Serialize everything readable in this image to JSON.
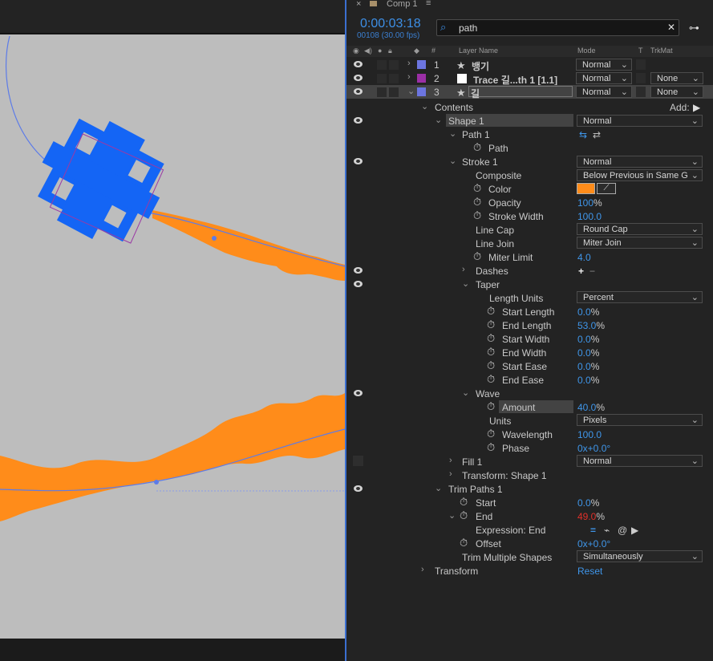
{
  "panel_tab": {
    "close_glyph": "×",
    "title": "Comp 1",
    "menu_glyph": "≡"
  },
  "timeline": {
    "timecode": "0:00:03:18",
    "frame_info": "00108 (30.00 fps)"
  },
  "search": {
    "value": "path",
    "icon": "search-icon",
    "clear_glyph": "✕"
  },
  "columns": {
    "label": "#",
    "name": "Layer Name",
    "mode": "Mode",
    "t": "T",
    "trkmat": "TrkMat"
  },
  "layers": [
    {
      "num": "1",
      "name": "뱅기",
      "mode": "Normal",
      "label_color": "#6c75e0",
      "icon": "star-icon"
    },
    {
      "num": "2",
      "name": "Trace 길...th 1 [1.1]",
      "mode": "Normal",
      "trkmat": "None",
      "label_color": "#9b2fa5",
      "icon": "solid-icon"
    },
    {
      "num": "3",
      "name": "길",
      "mode": "Normal",
      "trkmat": "None",
      "label_color": "#6c75e0",
      "icon": "star-icon"
    }
  ],
  "props": {
    "contents": "Contents",
    "add": "Add:",
    "shape1": "Shape 1",
    "shape1_mode": "Normal",
    "path1": "Path 1",
    "path": "Path",
    "stroke1": "Stroke 1",
    "stroke1_mode": "Normal",
    "composite": "Composite",
    "composite_val": "Below Previous in Same G",
    "color": "Color",
    "stroke_color": "#f5861c",
    "opacity": "Opacity",
    "opacity_val": "100",
    "pct": "%",
    "stroke_width": "Stroke Width",
    "stroke_width_val": "100.0",
    "line_cap": "Line Cap",
    "line_cap_val": "Round Cap",
    "line_join": "Line Join",
    "line_join_val": "Miter Join",
    "miter_limit": "Miter Limit",
    "miter_limit_val": "4.0",
    "dashes": "Dashes",
    "dash_add": "+",
    "dash_remove": "−",
    "taper": "Taper",
    "length_units": "Length Units",
    "length_units_val": "Percent",
    "start_length": "Start Length",
    "start_length_val": "0.0",
    "end_length": "End Length",
    "end_length_val": "53.0",
    "start_width": "Start Width",
    "start_width_val": "0.0",
    "end_width": "End Width",
    "end_width_val": "0.0",
    "start_ease": "Start Ease",
    "start_ease_val": "0.0",
    "end_ease": "End Ease",
    "end_ease_val": "0.0",
    "wave": "Wave",
    "amount": "Amount",
    "amount_val": "40.0",
    "units": "Units",
    "units_val": "Pixels",
    "wavelength": "Wavelength",
    "wavelength_val": "100.0",
    "phase": "Phase",
    "phase_val": "0x+0.0°",
    "fill1": "Fill 1",
    "fill1_mode": "Normal",
    "transform_shape": "Transform: Shape 1",
    "trim_paths": "Trim Paths 1",
    "start": "Start",
    "start_val": "0.0",
    "end": "End",
    "end_val": "49.0",
    "expression_end": "Expression: End",
    "offset": "Offset",
    "offset_val": "0x+0.0°",
    "trim_multiple": "Trim Multiple Shapes",
    "trim_multiple_val": "Simultaneously",
    "transform": "Transform",
    "reset": "Reset"
  },
  "colors": {
    "accent": "#3d8fe6",
    "expression_value": "#e0302a",
    "stroke_orange": "#ff8c1a",
    "shape_blue": "#1465f5"
  }
}
